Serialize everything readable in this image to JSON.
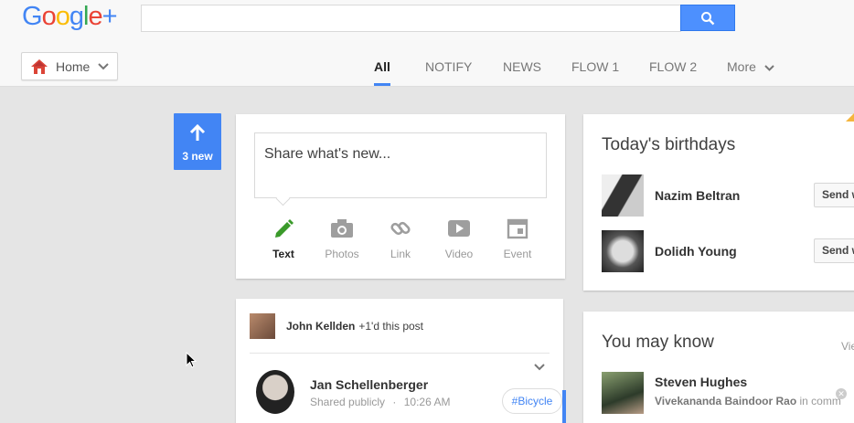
{
  "header": {
    "logo_text": "Google",
    "logo_plus": "+",
    "search": {
      "value": "",
      "placeholder": ""
    },
    "home_label": "Home"
  },
  "tabs": [
    {
      "label": "All",
      "active": true
    },
    {
      "label": "NOTIFY",
      "active": false
    },
    {
      "label": "NEWS",
      "active": false
    },
    {
      "label": "FLOW 1",
      "active": false
    },
    {
      "label": "FLOW 2",
      "active": false
    },
    {
      "label": "More",
      "active": false
    }
  ],
  "new_posts": {
    "label": "3 new"
  },
  "share": {
    "placeholder": "Share what's new...",
    "options": [
      {
        "label": "Text",
        "icon": "pencil-icon",
        "selected": true
      },
      {
        "label": "Photos",
        "icon": "camera-icon",
        "selected": false
      },
      {
        "label": "Link",
        "icon": "link-icon",
        "selected": false
      },
      {
        "label": "Video",
        "icon": "video-icon",
        "selected": false
      },
      {
        "label": "Event",
        "icon": "event-icon",
        "selected": false
      }
    ]
  },
  "post": {
    "plus_user": "John Kellden",
    "plus_text": "+1'd this post",
    "author": "Jan Schellenberger",
    "visibility": "Shared publicly",
    "separator": "·",
    "time": "10:26 AM",
    "hashtag": "#Bicycle"
  },
  "birthdays": {
    "title": "Today's birthdays",
    "people": [
      {
        "name": "Nazim Beltran",
        "button": "Send w"
      },
      {
        "name": "Dolidh Young",
        "button": "Send w"
      }
    ]
  },
  "you_may_know": {
    "title": "You may know",
    "view_link": "Vie",
    "person": {
      "name": "Steven Hughes",
      "mutual_name": "Vivekananda Baindoor Rao",
      "mutual_text": "in comm"
    }
  },
  "colors": {
    "accent": "#4285f4",
    "search_button": "#4d90fe",
    "text_option_selected": "#3a9a2a"
  }
}
